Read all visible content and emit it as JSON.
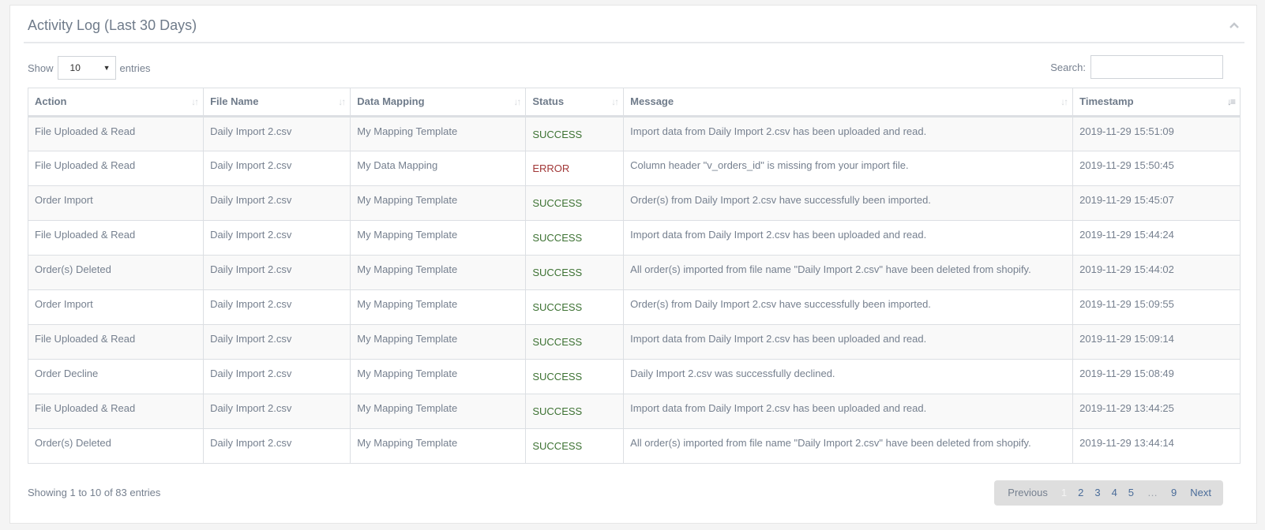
{
  "panel": {
    "title": "Activity Log (Last 30 Days)",
    "collapse_icon": "chevron-up-icon"
  },
  "length": {
    "show_label": "Show",
    "selected": "10",
    "entries_label": "entries"
  },
  "search": {
    "label": "Search:",
    "value": "",
    "placeholder": ""
  },
  "table": {
    "columns": [
      {
        "label": "Action",
        "sort": "sort-both-icon"
      },
      {
        "label": "File Name",
        "sort": "sort-both-icon"
      },
      {
        "label": "Data Mapping",
        "sort": "sort-both-icon"
      },
      {
        "label": "Status",
        "sort": "sort-both-icon"
      },
      {
        "label": "Message",
        "sort": "sort-both-icon"
      },
      {
        "label": "Timestamp",
        "sort": "sort-desc-icon"
      }
    ],
    "rows": [
      {
        "action": "File Uploaded & Read",
        "file": "Daily Import 2.csv",
        "mapping": "My Mapping Template",
        "status": "SUCCESS",
        "message": "Import data from Daily Import 2.csv has been uploaded and read.",
        "timestamp": "2019-11-29 15:51:09"
      },
      {
        "action": "File Uploaded & Read",
        "file": "Daily Import 2.csv",
        "mapping": "My Data Mapping",
        "status": "ERROR",
        "message": "Column header \"v_orders_id\" is missing from your import file.",
        "timestamp": "2019-11-29 15:50:45"
      },
      {
        "action": "Order Import",
        "file": "Daily Import 2.csv",
        "mapping": "My Mapping Template",
        "status": "SUCCESS",
        "message": "Order(s) from Daily Import 2.csv have successfully been imported.",
        "timestamp": "2019-11-29 15:45:07"
      },
      {
        "action": "File Uploaded & Read",
        "file": "Daily Import 2.csv",
        "mapping": "My Mapping Template",
        "status": "SUCCESS",
        "message": "Import data from Daily Import 2.csv has been uploaded and read.",
        "timestamp": "2019-11-29 15:44:24"
      },
      {
        "action": "Order(s) Deleted",
        "file": "Daily Import 2.csv",
        "mapping": "My Mapping Template",
        "status": "SUCCESS",
        "message": "All order(s) imported from file name \"Daily Import 2.csv\" have been deleted from shopify.",
        "timestamp": "2019-11-29 15:44:02"
      },
      {
        "action": "Order Import",
        "file": "Daily Import 2.csv",
        "mapping": "My Mapping Template",
        "status": "SUCCESS",
        "message": "Order(s) from Daily Import 2.csv have successfully been imported.",
        "timestamp": "2019-11-29 15:09:55"
      },
      {
        "action": "File Uploaded & Read",
        "file": "Daily Import 2.csv",
        "mapping": "My Mapping Template",
        "status": "SUCCESS",
        "message": "Import data from Daily Import 2.csv has been uploaded and read.",
        "timestamp": "2019-11-29 15:09:14"
      },
      {
        "action": "Order Decline",
        "file": "Daily Import 2.csv",
        "mapping": "My Mapping Template",
        "status": "SUCCESS",
        "message": "Daily Import 2.csv was successfully declined.",
        "timestamp": "2019-11-29 15:08:49"
      },
      {
        "action": "File Uploaded & Read",
        "file": "Daily Import 2.csv",
        "mapping": "My Mapping Template",
        "status": "SUCCESS",
        "message": "Import data from Daily Import 2.csv has been uploaded and read.",
        "timestamp": "2019-11-29 13:44:25"
      },
      {
        "action": "Order(s) Deleted",
        "file": "Daily Import 2.csv",
        "mapping": "My Mapping Template",
        "status": "SUCCESS",
        "message": "All order(s) imported from file name \"Daily Import 2.csv\" have been deleted from shopify.",
        "timestamp": "2019-11-29 13:44:14"
      }
    ]
  },
  "info": "Showing 1 to 10 of 83 entries",
  "pagination": {
    "previous": "Previous",
    "pages": [
      "1",
      "2",
      "3",
      "4",
      "5",
      "…",
      "9"
    ],
    "current": "1",
    "next": "Next"
  },
  "colors": {
    "success": "#3d7233",
    "error": "#a13737",
    "link": "#4a6c99"
  }
}
